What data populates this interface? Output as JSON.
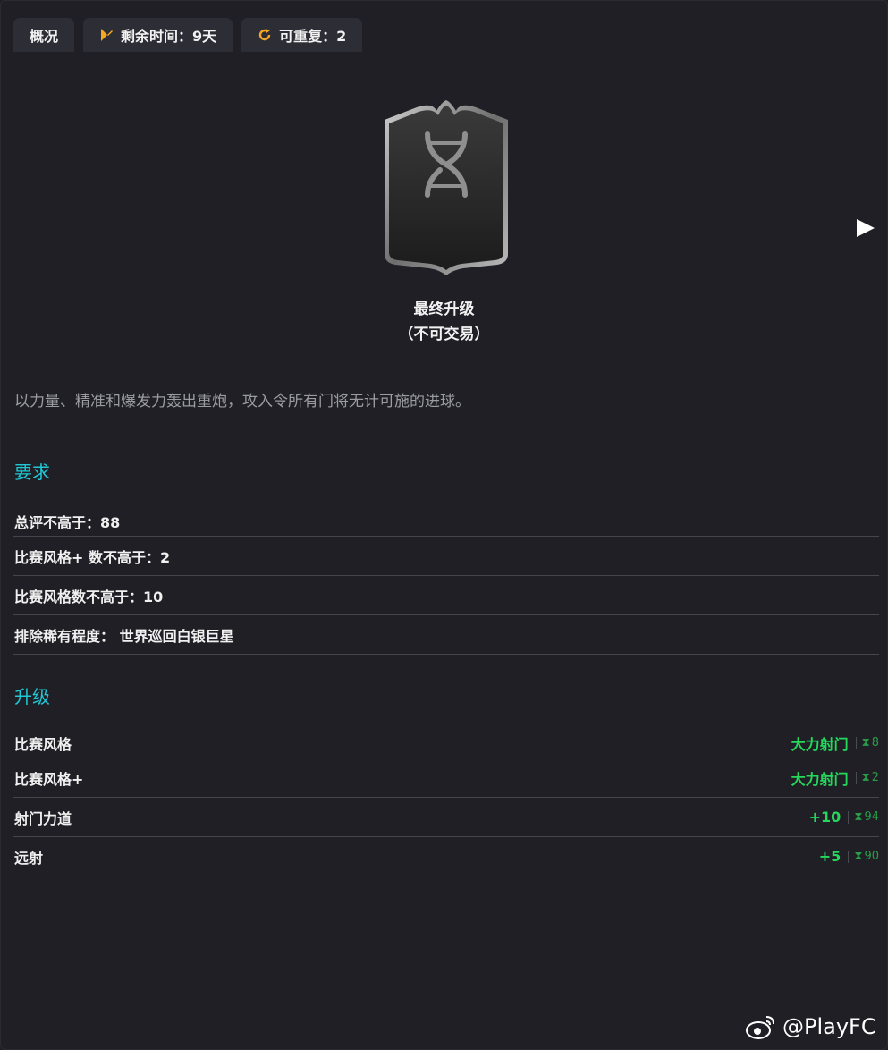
{
  "tabs": [
    {
      "label": "概况",
      "icon": ""
    },
    {
      "label": "剩余时间：9天",
      "icon": "pencil-flag-icon"
    },
    {
      "label": "可重复：2",
      "icon": "refresh-icon"
    }
  ],
  "card": {
    "icon": "dna-icon",
    "title_line1": "最终升级",
    "title_line2": "（不可交易）"
  },
  "description": "以力量、精准和爆发力轰出重炮，攻入令所有门将无计可施的进球。",
  "requirements": {
    "heading": "要求",
    "items": [
      "总评不高于：88",
      "比赛风格+ 数不高于：2",
      "比赛风格数不高于：10",
      "排除稀有程度： 世界巡回白银巨星"
    ]
  },
  "upgrades": {
    "heading": "升级",
    "items": [
      {
        "label": "比赛风格",
        "value": "大力射门",
        "cap": "8"
      },
      {
        "label": "比赛风格+",
        "value": "大力射门",
        "cap": "2"
      },
      {
        "label": "射门力道",
        "value": "+10",
        "cap": "94"
      },
      {
        "label": "远射",
        "value": "+5",
        "cap": "90"
      }
    ]
  },
  "watermark": "@PlayFC",
  "colors": {
    "accent": "#1fc8d6",
    "positive": "#25d85c",
    "icon_orange": "#f5a623",
    "background": "#1f1f25"
  }
}
